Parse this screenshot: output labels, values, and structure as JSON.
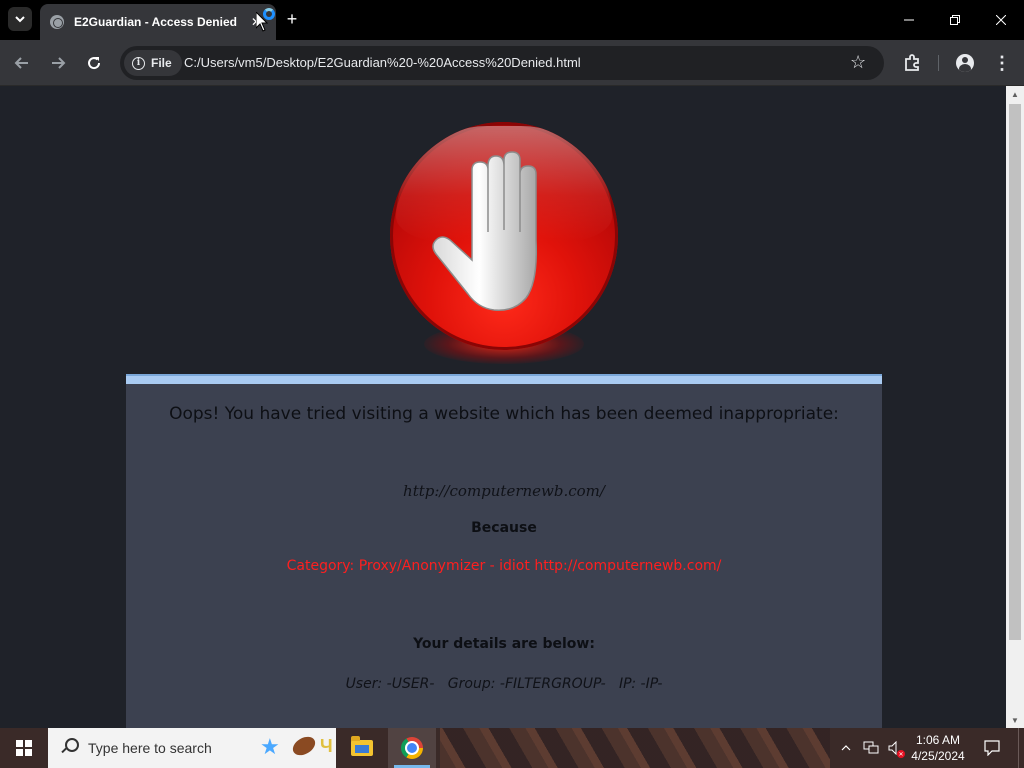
{
  "browser": {
    "tab_title": "E2Guardian - Access Denied",
    "tab_close": "✕",
    "new_tab": "+",
    "file_chip_label": "File",
    "url": "C:/Users/vm5/Desktop/E2Guardian%20-%20Access%20Denied.html",
    "icons": {
      "tab_list": "chevron-down-icon",
      "back": "back-arrow-icon",
      "forward": "forward-arrow-icon",
      "reload": "reload-icon",
      "info": "info-icon",
      "bookmark": "star-icon",
      "extensions": "puzzle-icon",
      "profile": "profile-icon",
      "menu": "kebab-menu-icon"
    }
  },
  "page": {
    "headline": "Oops! You have tried visiting a website which has been deemed inappropriate:",
    "blocked_url": "http://computernewb.com/",
    "because_label": "Because",
    "reason": "Category: Proxy/Anonymizer - idiot http://computernewb.com/",
    "details_heading": "Your details are below:",
    "details": "User: -USER-   Group: -FILTERGROUP-   IP: -IP-",
    "colors": {
      "background": "#1f2229",
      "box": "#3c4150",
      "box_topbar": "#a9cbf2",
      "reason_text": "#ff1f1f",
      "stop_sign": "#e0120a"
    }
  },
  "taskbar": {
    "search_placeholder": "Type here to search",
    "time": "1:06 AM",
    "date": "4/25/2024",
    "apps": [
      "file-explorer",
      "google-chrome"
    ]
  }
}
